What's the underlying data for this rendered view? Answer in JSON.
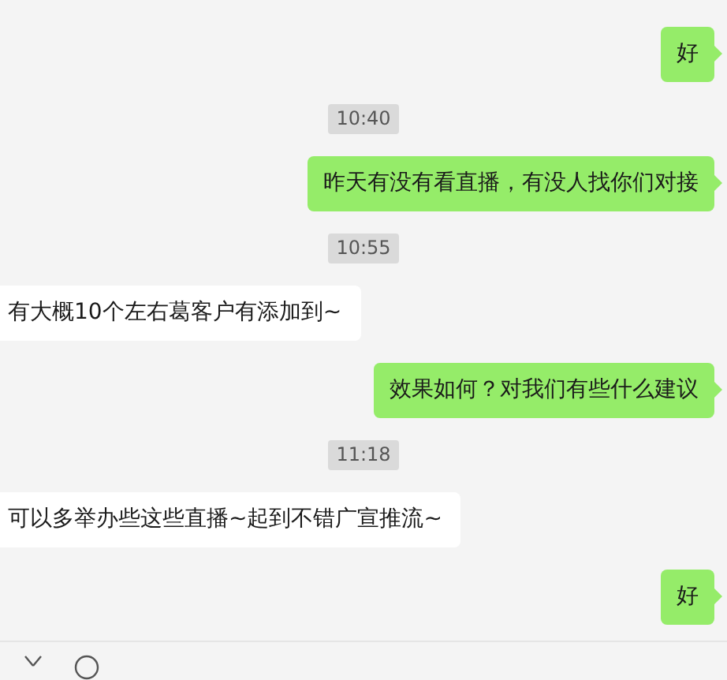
{
  "messages": [
    {
      "kind": "sent",
      "text": "好"
    },
    {
      "kind": "time",
      "text": "10:40"
    },
    {
      "kind": "sent",
      "text": "昨天有没有看直播，有没人找你们对接"
    },
    {
      "kind": "time",
      "text": "10:55"
    },
    {
      "kind": "received",
      "text": "有大概10个左右葛客户有添加到~"
    },
    {
      "kind": "sent",
      "text": "效果如何？对我们有些什么建议"
    },
    {
      "kind": "time",
      "text": "11:18"
    },
    {
      "kind": "received",
      "text": "可以多举办些这些直播~起到不错广宣推流~"
    },
    {
      "kind": "sent",
      "text": "好"
    }
  ]
}
